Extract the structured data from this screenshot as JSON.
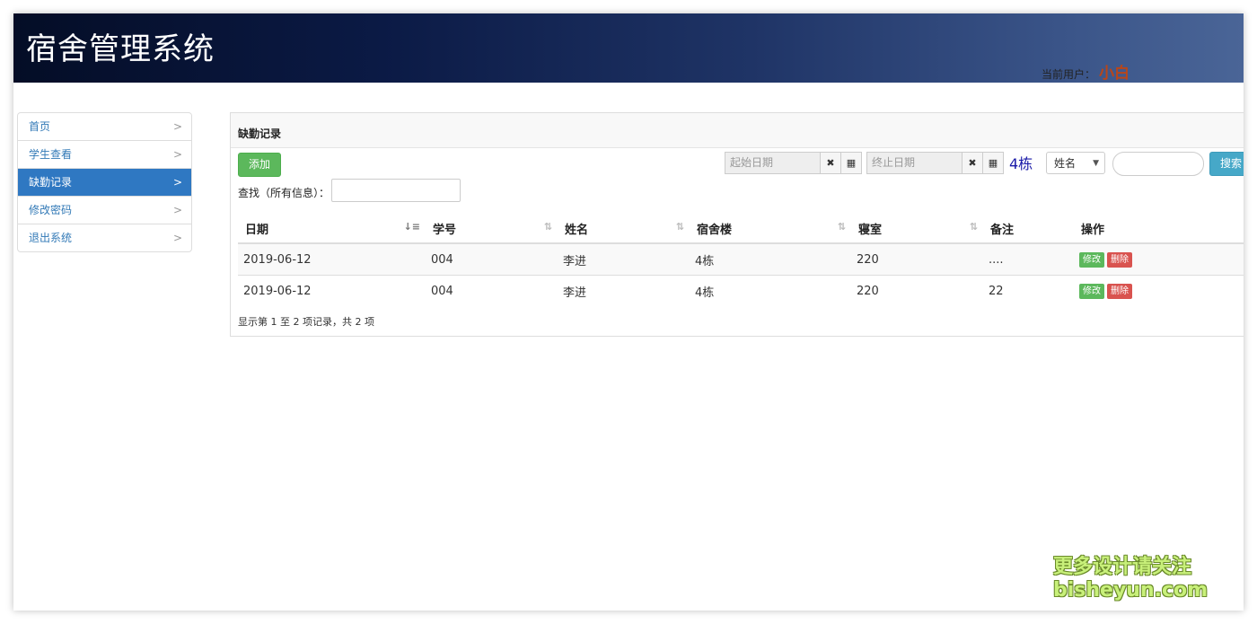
{
  "app": {
    "title": "宿舍管理系统",
    "user_label": "当前用户：",
    "user_name": "小白"
  },
  "sidebar": {
    "items": [
      {
        "label": "首页",
        "active": false
      },
      {
        "label": "学生查看",
        "active": false
      },
      {
        "label": "缺勤记录",
        "active": true
      },
      {
        "label": "修改密码",
        "active": false
      },
      {
        "label": "退出系统",
        "active": false
      }
    ]
  },
  "panel": {
    "title": "缺勤记录",
    "add_label": "添加",
    "start_date_placeholder": "起始日期",
    "end_date_placeholder": "终止日期",
    "building": "4栋",
    "filter_selected": "姓名",
    "search_label": "搜索",
    "find_label": "查找（所有信息）："
  },
  "table": {
    "columns": [
      "日期",
      "学号",
      "姓名",
      "宿舍楼",
      "寝室",
      "备注",
      "操作"
    ],
    "rows": [
      {
        "date": "2019-06-12",
        "id": "004",
        "name": "李进",
        "building": "4栋",
        "room": "220",
        "note": "...."
      },
      {
        "date": "2019-06-12",
        "id": "004",
        "name": "李进",
        "building": "4栋",
        "room": "220",
        "note": "22"
      }
    ],
    "edit_label": "修改",
    "delete_label": "删除",
    "info": "显示第 1 至 2 项记录，共 2 项"
  },
  "watermark": {
    "line1": "更多设计请关注",
    "line2": "bisheyun.com"
  }
}
